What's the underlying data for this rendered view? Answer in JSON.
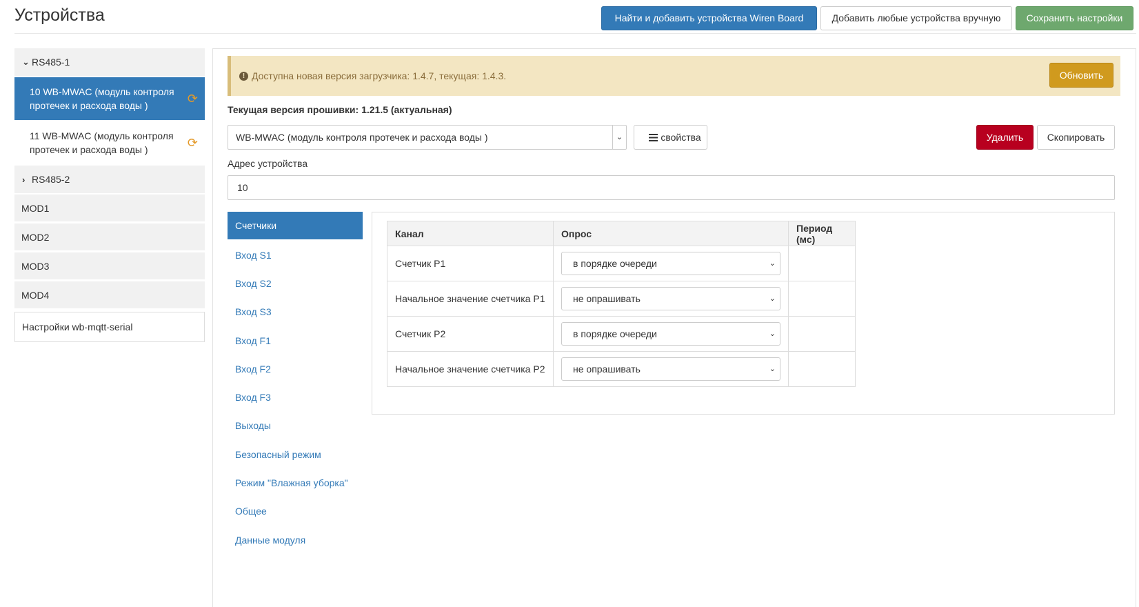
{
  "header": {
    "title": "Устройства",
    "find_button": "Найти и добавить устройства Wiren Board",
    "add_button": "Добавить любые устройства вручную",
    "save_button": "Сохранить настройки"
  },
  "sidebar": {
    "ports": [
      {
        "label": "RS485-1",
        "expanded": true
      },
      {
        "label": "RS485-2",
        "expanded": false
      }
    ],
    "devices": [
      {
        "label": "10 WB-MWAC (модуль контроля протечек и расхода воды )",
        "active": true
      },
      {
        "label": "11 WB-MWAC (модуль контроля протечек и расхода воды )",
        "active": false
      }
    ],
    "mods": [
      "MOD1",
      "MOD2",
      "MOD3",
      "MOD4"
    ],
    "settings": "Настройки wb-mqtt-serial"
  },
  "alert": {
    "text": "Доступна новая версия загрузчика: 1.4.7, текущая: 1.4.3.",
    "button": "Обновить"
  },
  "firmware_label": "Текущая версия прошивки: 1.21.5 (актуальная)",
  "device_type": "WB-MWAC (модуль контроля протечек и расхода воды )",
  "props_button": "свойства",
  "delete_button": "Удалить",
  "copy_button": "Скопировать",
  "address": {
    "label": "Адрес устройства",
    "value": "10"
  },
  "tabs": [
    "Счетчики",
    "Вход S1",
    "Вход S2",
    "Вход S3",
    "Вход F1",
    "Вход F2",
    "Вход F3",
    "Выходы",
    "Безопасный режим",
    "Режим \"Влажная уборка\"",
    "Общее",
    "Данные модуля"
  ],
  "table": {
    "headers": [
      "Канал",
      "Опрос",
      "Период (мс)"
    ],
    "rows": [
      {
        "channel": "Счетчик P1",
        "poll": "в порядке очереди",
        "period": ""
      },
      {
        "channel": "Начальное значение счетчика P1",
        "poll": "не опрашивать",
        "period": ""
      },
      {
        "channel": "Счетчик P2",
        "poll": "в порядке очереди",
        "period": ""
      },
      {
        "channel": "Начальное значение счетчика P2",
        "poll": "не опрашивать",
        "period": ""
      }
    ]
  },
  "colors": {
    "primary": "#337ab7",
    "success": "#6ea86e",
    "danger": "#b8001f",
    "warning": "#d09a1e",
    "alert_bg": "#f3e6c2",
    "sync_icon": "#e49a2a"
  }
}
